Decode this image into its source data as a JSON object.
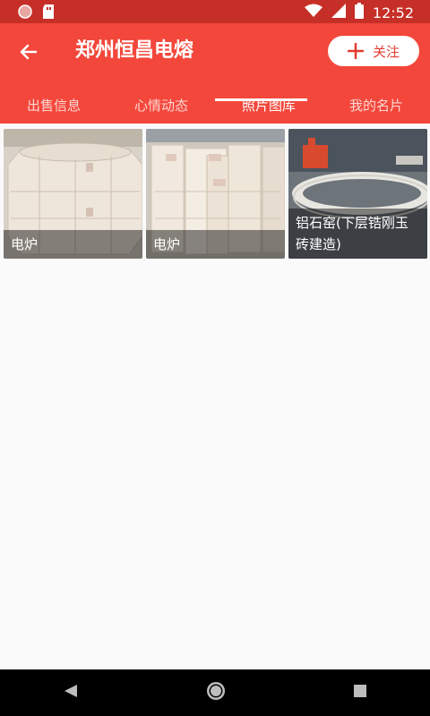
{
  "status_bar": {
    "time": "12:52",
    "icons": [
      "record-icon",
      "sd-card-icon",
      "wifi-icon",
      "signal-icon",
      "battery-icon"
    ]
  },
  "header": {
    "title": "郑州恒昌电熔",
    "follow_label": "关注",
    "icons": [
      "back-arrow-icon",
      "plus-icon"
    ]
  },
  "tabs": [
    {
      "label": "出售信息",
      "active": false
    },
    {
      "label": "心情动态",
      "active": false
    },
    {
      "label": "照片图库",
      "active": true
    },
    {
      "label": "我的名片",
      "active": false
    }
  ],
  "gallery": [
    {
      "caption": "电炉"
    },
    {
      "caption": "电炉"
    },
    {
      "caption": "铝石窑(下层锆刚玉砖建造)"
    }
  ],
  "nav": {
    "icons": [
      "back-triangle-icon",
      "home-circle-icon",
      "recents-square-icon"
    ]
  },
  "colors": {
    "primary": "#f3473b",
    "status_bar": "#c62f27",
    "accent_text": "#e23b31"
  }
}
